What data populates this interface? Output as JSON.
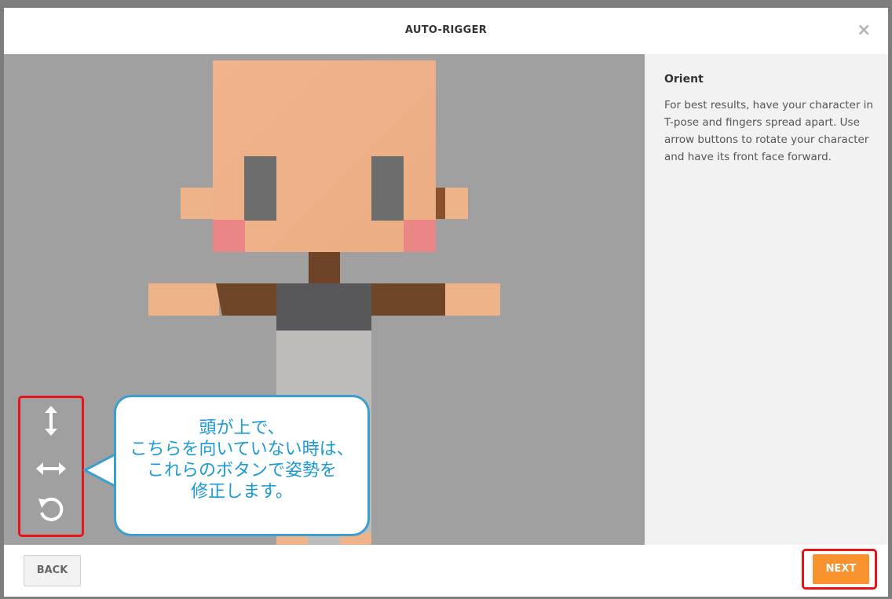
{
  "modal": {
    "title": "AUTO-RIGGER",
    "close_icon": "close-icon"
  },
  "panel": {
    "title": "Orient",
    "description": "For best results, have your character in T-pose and fingers spread apart. Use arrow buttons to rotate your character and have its front face forward."
  },
  "controls": {
    "flip_vertical_icon": "vertical-arrow-icon",
    "flip_horizontal_icon": "horizontal-arrow-icon",
    "rotate_icon": "rotate-icon"
  },
  "callout": {
    "lines": [
      "頭が上で、",
      "こちらを向いていない時は、",
      "これらのボタンで姿勢を",
      "修正します。"
    ]
  },
  "footer": {
    "back_label": "BACK",
    "next_label": "NEXT"
  },
  "colors": {
    "accent": "#f7922e",
    "highlight": "#e8141b",
    "callout_border": "#3a9fcf",
    "callout_text": "#1c9ad6",
    "skin": "#f0b48a",
    "shirt": "#58575a",
    "sleeve": "#6f4528"
  }
}
